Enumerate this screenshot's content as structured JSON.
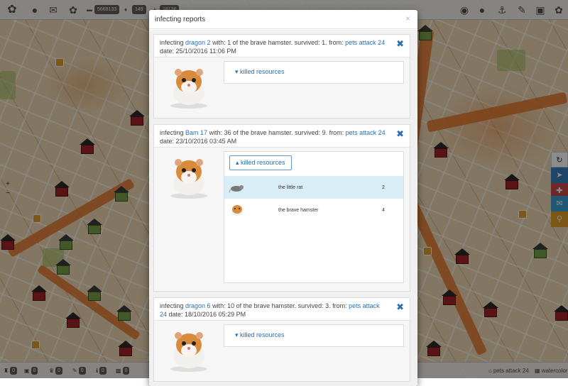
{
  "topbar": {
    "badges": [
      "5668133",
      "149",
      "18136"
    ]
  },
  "bottombar": {
    "counts": [
      "0",
      "0",
      "0",
      "0",
      "0",
      "0"
    ],
    "right_label": "pets attack 24",
    "layer_label": "watercolor"
  },
  "zoom": {
    "in_label": "+",
    "out_label": "−"
  },
  "modal": {
    "title": "infecting reports",
    "close_label": "×",
    "reports": [
      {
        "prefix": "infecting ",
        "target": "dragon 2",
        "middle": " with: 1 of the brave hamster. survived: 1. from: ",
        "source": "pets attack 24",
        "date_text": " date: 25/10/2016 11:06 PM",
        "toggle_label": "▾ killed resources"
      },
      {
        "prefix": "infecting ",
        "target": "Bam 17",
        "middle": " with: 36 of the brave hamster. survived: 9. from: ",
        "source": "pets attack 24",
        "date_text": " date: 23/10/2016 03:45 AM",
        "toggle_label": "▴ killed resources",
        "resources": [
          {
            "name": "the little rat",
            "count": "2"
          },
          {
            "name": "the brave hamster",
            "count": "4"
          }
        ]
      },
      {
        "prefix": "infecting ",
        "target": "dragon 6",
        "middle": " with: 10 of the brave hamster. survived: 3. from: ",
        "source": "pets attack 24",
        "date_text": " date: 18/10/2016 05:29 PM",
        "toggle_label": "▾ killed resources"
      }
    ]
  },
  "colors": {
    "link": "#2a6fb0",
    "side_buttons": [
      "#3a7fc0",
      "#c94a4a",
      "#3b9fd6",
      "#e0a02a"
    ]
  }
}
